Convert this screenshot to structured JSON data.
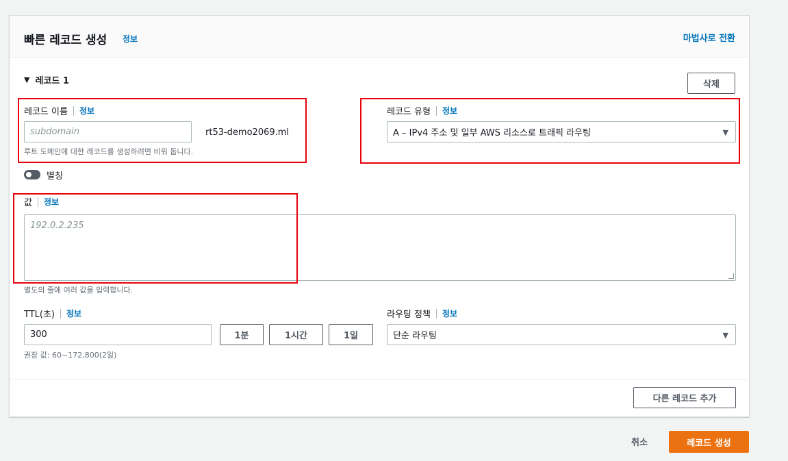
{
  "header": {
    "title": "빠른 레코드 생성",
    "info": "정보",
    "wizard_link": "마법사로 전환"
  },
  "record": {
    "section_title": "레코드 1",
    "delete_label": "삭제",
    "name": {
      "label": "레코드 이름",
      "info": "정보",
      "placeholder": "subdomain",
      "suffix": "rt53-demo2069.ml",
      "help": "루트 도메인에 대한 레코드를 생성하려면 비워 둡니다."
    },
    "type": {
      "label": "레코드 유형",
      "info": "정보",
      "selected": "A – IPv4 주소 및 일부 AWS 리소스로 트래픽 라우팅"
    },
    "alias": {
      "label": "별칭",
      "enabled": false
    },
    "value": {
      "label": "값",
      "info": "정보",
      "placeholder": "192.0.2.235",
      "help": "별도의 줄에 여러 값을 입력합니다."
    },
    "ttl": {
      "label": "TTL(초)",
      "info": "정보",
      "value": "300",
      "help": "권장 값: 60~172,800(2일)",
      "presets": [
        "1분",
        "1시간",
        "1일"
      ]
    },
    "routing": {
      "label": "라우팅 정책",
      "info": "정보",
      "selected": "단순 라우팅"
    },
    "add_record_label": "다른 레코드 추가"
  },
  "actions": {
    "cancel_label": "취소",
    "create_label": "레코드 생성"
  },
  "colors": {
    "primary_button": "#ec7211",
    "link": "#0073bb",
    "highlight_box": "#e8000b"
  }
}
